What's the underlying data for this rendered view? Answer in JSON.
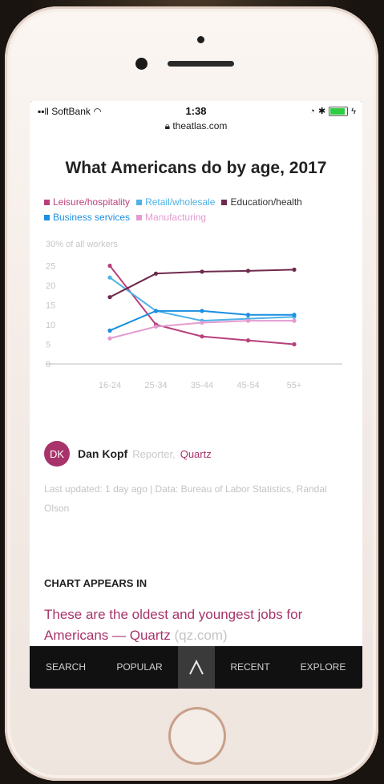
{
  "status_bar": {
    "carrier": "SoftBank",
    "time": "1:38",
    "url": "theatlas.com"
  },
  "page": {
    "title": "What Americans do by age, 2017"
  },
  "chart_data": {
    "type": "line",
    "ylabel": "30% of all workers",
    "categories": [
      "16-24",
      "25-34",
      "35-44",
      "45-54",
      "55+"
    ],
    "yticks": [
      "25",
      "20",
      "15",
      "10",
      "5",
      "0"
    ],
    "ylim": [
      0,
      30
    ],
    "grid": false,
    "legend": "top",
    "series": [
      {
        "name": "Leisure/hospitality",
        "color": "#b8407a",
        "values": [
          25,
          10,
          7,
          6,
          5
        ]
      },
      {
        "name": "Retail/wholesale",
        "color": "#4fb2e8",
        "values": [
          22,
          13.5,
          11,
          11.5,
          12
        ]
      },
      {
        "name": "Education/health",
        "color": "#6e2b4d",
        "values": [
          17,
          23,
          23.5,
          23.7,
          24
        ]
      },
      {
        "name": "Business services",
        "color": "#1b8fe0",
        "values": [
          8.5,
          13.5,
          13.5,
          12.5,
          12.5
        ]
      },
      {
        "name": "Manufacturing",
        "color": "#e49bd0",
        "values": [
          6.5,
          9.5,
          10.5,
          11,
          11
        ]
      }
    ]
  },
  "author": {
    "initials": "DK",
    "name": "Dan Kopf",
    "role": "Reporter,",
    "org": "Quartz"
  },
  "meta": {
    "text": "Last updated: 1 day ago  |  Data: Bureau of Labor Statistics, Randal Olson"
  },
  "appears_in": {
    "label": "CHART APPEARS IN",
    "link": "These are the oldest and youngest jobs for Americans — Quartz",
    "source": "(qz.com)"
  },
  "tabbar": {
    "search": "SEARCH",
    "popular": "POPULAR",
    "recent": "RECENT",
    "explore": "EXPLORE"
  }
}
